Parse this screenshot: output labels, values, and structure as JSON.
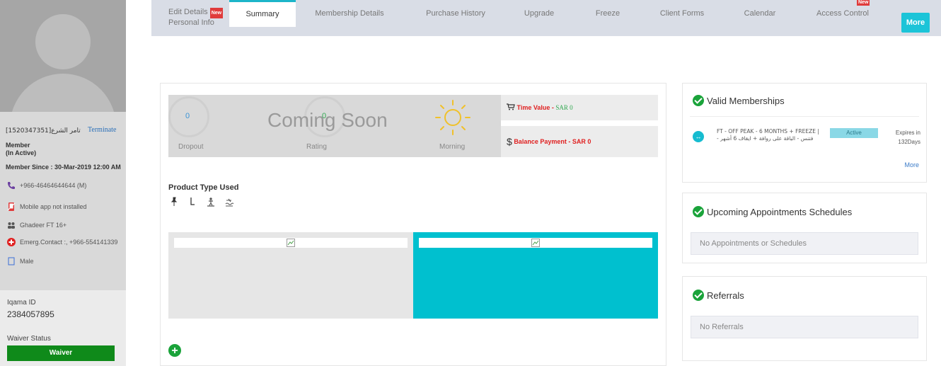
{
  "profile": {
    "name": "[1520347351]تامر الشرع",
    "terminate_label": "Terminate",
    "member_type": "Member",
    "member_status": "(In Active)",
    "member_since_label": "Member Since : ",
    "member_since_value": "30-Mar-2019 12:00 AM",
    "phone": "+966-46464644644 (M)",
    "app_status": "Mobile app not installed",
    "branch": "Ghadeer FT 16+",
    "emergency_contact": "Emerg.Contact :, +966-554141339",
    "gender": "Male",
    "iqama_label": "Iqama ID",
    "iqama_value": "2384057895",
    "waiver_label": "Waiver Status",
    "waiver_button": "Waiver"
  },
  "tabs": {
    "edit_line1": "Edit Details",
    "edit_line2": "Personal Info",
    "new_badge": "New",
    "summary": "Summary",
    "membership": "Membership Details",
    "purchase": "Purchase History",
    "upgrade": "Upgrade",
    "freeze": "Freeze",
    "client_forms": "Client Forms",
    "calendar": "Calendar",
    "access_control": "Access Control",
    "more": "More"
  },
  "stats": {
    "dropout_value": "0",
    "dropout_label": "Dropout",
    "rating_value": "0",
    "rating_label": "Rating",
    "morning_label": "Morning",
    "coming_soon": "Coming Soon",
    "time_value_label": "Time Value - ",
    "time_value_amount": "SAR 0",
    "balance_label": "Balance Payment - ",
    "balance_amount": "SAR 0"
  },
  "product_type": {
    "title": "Product Type Used"
  },
  "memberships": {
    "title": "Valid Memberships",
    "item_name": "FT - OFF PEAK - 6 MONTHS + FREEZE | - فتنس - الباقة على روافة + ايقاف 6 أشهر",
    "item_status": "Active",
    "item_expiry_line1": "Expires in",
    "item_expiry_line2": "132Days",
    "more_label": "More"
  },
  "appointments": {
    "title": "Upcoming Appointments Schedules",
    "empty": "No Appointments or Schedules"
  },
  "referrals": {
    "title": "Referrals",
    "empty": "No Referrals"
  },
  "colors": {
    "accent": "#1cc4d8",
    "green": "#1aa33a",
    "waiver": "#0f8a1a",
    "tabbar": "#d9dde6"
  }
}
